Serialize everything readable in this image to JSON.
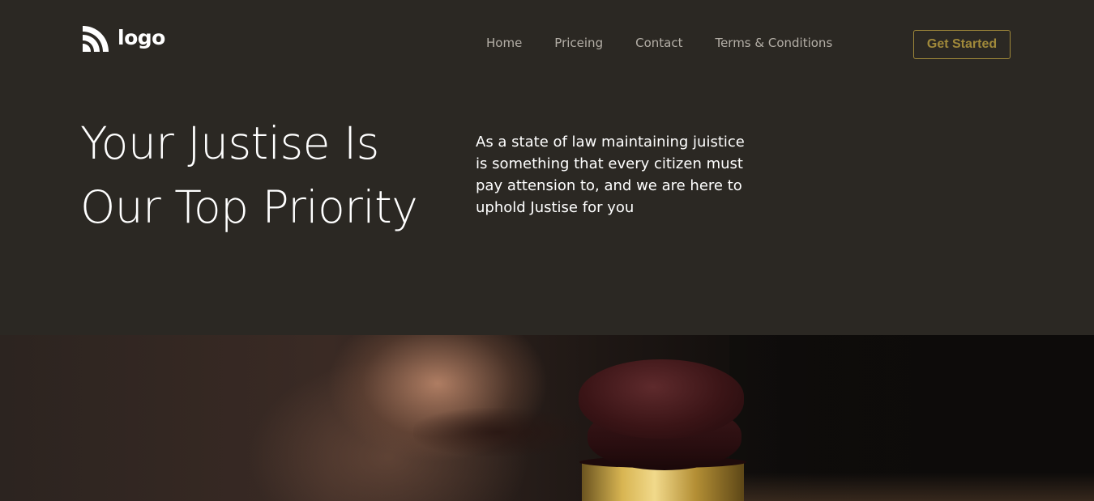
{
  "header": {
    "logo_text": "logo",
    "nav": [
      {
        "label": "Home"
      },
      {
        "label": "Priceing"
      },
      {
        "label": "Contact"
      },
      {
        "label": "Terms & Conditions"
      }
    ],
    "cta_label": "Get Started"
  },
  "hero": {
    "title_line1": "Your Justise Is",
    "title_line2": "Our Top Priority",
    "text": "As a state of law maintaining juistice is something that every citizen must pay attension to, and we are here to uphold Justise for you"
  },
  "colors": {
    "background": "#2b2823",
    "accent": "#a0893a",
    "nav_text": "#b3aea6",
    "text": "#ffffff"
  },
  "icons": {
    "logo": "rss-like-logo-icon"
  }
}
